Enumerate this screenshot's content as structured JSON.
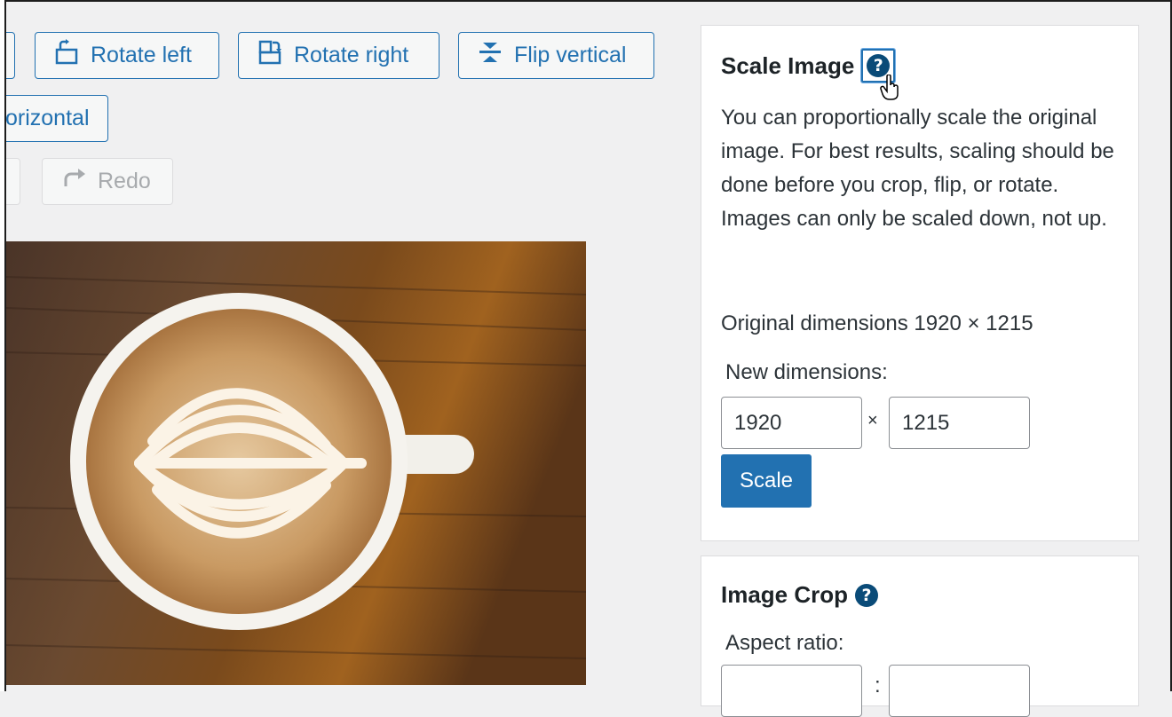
{
  "toolbar": {
    "rotate_left": "Rotate left",
    "rotate_right": "Rotate right",
    "flip_vertical": "Flip vertical",
    "flip_horizontal": "orizontal",
    "redo": "Redo"
  },
  "scale_panel": {
    "title": "Scale Image",
    "help": "?",
    "description": "You can proportionally scale the original image. For best results, scaling should be done before you crop, flip, or rotate. Images can only be scaled down, not up.",
    "original_dimensions": "Original dimensions 1920 × 1215",
    "new_dimensions_label": "New dimensions:",
    "width_value": "1920",
    "separator": "×",
    "height_value": "1215",
    "scale_button": "Scale"
  },
  "crop_panel": {
    "title": "Image Crop",
    "help": "?",
    "aspect_ratio_label": "Aspect ratio:",
    "separator": ":"
  },
  "colors": {
    "accent": "#2271b1",
    "help_icon": "#0a4b78"
  },
  "icons": [
    "rotate-left-icon",
    "rotate-right-icon",
    "flip-vertical-icon",
    "redo-icon",
    "help-icon",
    "hand-cursor-icon"
  ]
}
